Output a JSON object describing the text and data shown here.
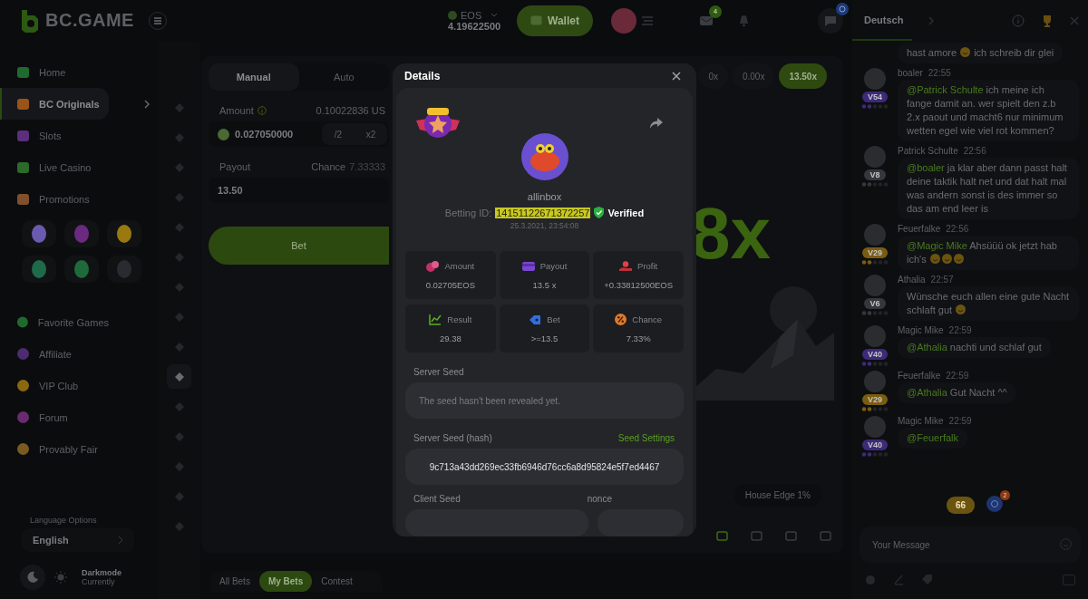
{
  "header": {
    "logo": "BC.GAME",
    "currency": "EOS",
    "balance": "4.19622500",
    "wallet": "Wallet",
    "mail_badge": "4"
  },
  "sidebar": {
    "items": [
      {
        "label": "Home",
        "selected": false
      },
      {
        "label": "BC Originals",
        "selected": true
      },
      {
        "label": "Slots",
        "selected": false
      },
      {
        "label": "Live Casino",
        "selected": false
      },
      {
        "label": "Promotions",
        "selected": false
      }
    ],
    "more_items": [
      {
        "label": "Favorite Games",
        "selected": false
      },
      {
        "label": "Affiliate",
        "selected": false
      },
      {
        "label": "VIP Club",
        "selected": false
      },
      {
        "label": "Forum",
        "selected": false
      },
      {
        "label": "Provably Fair",
        "selected": false
      }
    ],
    "language_label": "Language Options",
    "language": "English",
    "theme_title": "Darkmode",
    "theme_subtitle": "Currently"
  },
  "game_rail": [
    {
      "selected": false
    },
    {
      "selected": false
    },
    {
      "selected": false
    },
    {
      "selected": false
    },
    {
      "selected": false
    },
    {
      "selected": false
    },
    {
      "selected": false
    },
    {
      "selected": false
    },
    {
      "selected": false
    },
    {
      "selected": true
    },
    {
      "selected": false
    },
    {
      "selected": false
    },
    {
      "selected": false
    },
    {
      "selected": false
    },
    {
      "selected": false
    }
  ],
  "game": {
    "tabs": [
      {
        "label": "Manual",
        "selected": true
      },
      {
        "label": "Auto",
        "selected": false
      }
    ],
    "amount_label": "Amount",
    "amount_usd": "0.10022836 US",
    "amount_value": "0.027050000",
    "amount_buttons": [
      "/2",
      "x2"
    ],
    "payout_label": "Payout",
    "chance_label": "Chance",
    "chance_value": "7.33333",
    "payout_value": "13.50",
    "bet_button": "Bet",
    "history": [
      {
        "label": "0x",
        "win": false
      },
      {
        "label": "0.00x",
        "win": false
      },
      {
        "label": "13.50x",
        "win": true
      }
    ],
    "result": "8x",
    "house_edge": "House Edge 1%",
    "toolbar": [
      {
        "selected": true
      },
      {
        "selected": false
      },
      {
        "selected": false
      },
      {
        "selected": false
      }
    ]
  },
  "bets_tabs": [
    {
      "label": "All Bets",
      "selected": false
    },
    {
      "label": "My Bets",
      "selected": true
    },
    {
      "label": "Contest",
      "selected": false
    }
  ],
  "details": {
    "title": "Details",
    "username": "allinbox",
    "betting_id_label": "Betting ID:",
    "betting_id": "14151122671372257",
    "verified": "Verified",
    "date": "25.3.2021, 23:54:08",
    "stats": [
      {
        "kind": "amount",
        "label": "Amount",
        "value": "0.02705EOS"
      },
      {
        "kind": "payout",
        "label": "Payout",
        "value": "13.5 x"
      },
      {
        "kind": "profit",
        "label": "Profit",
        "value": "+0.33812500EOS"
      },
      {
        "kind": "result",
        "label": "Result",
        "value": "29.38"
      },
      {
        "kind": "bet",
        "label": "Bet",
        "value": ">=13.5"
      },
      {
        "kind": "chance",
        "label": "Chance",
        "value": "7.33%"
      }
    ],
    "server_seed_label": "Server Seed",
    "server_seed": "The seed hasn't been revealed yet.",
    "hash_label": "Server Seed (hash)",
    "seed_settings": "Seed Settings",
    "hash": "9c713a43dd269ec33fb6946d76cc6a8d95824e5f7ed4467",
    "client_seed_label": "Client Seed",
    "nonce_label": "nonce"
  },
  "chat": {
    "tab": "Deutsch",
    "placeholder": "Your Message",
    "unread": "66",
    "mention_badge": "2",
    "messages": [
      {
        "parts": [
          {
            "kind": "text",
            "text": "hast amore "
          },
          {
            "kind": "emoji"
          },
          {
            "kind": "text",
            "text": " ich schreib dir glei"
          }
        ]
      },
      {
        "name": "boaler",
        "time": "22:55",
        "level": "V54",
        "color": "#3d2a78",
        "parts": [
          {
            "kind": "mention",
            "text": "@Patrick Schulte"
          },
          {
            "kind": "text",
            "text": " ich meine ich fange damit an. wer spielt den z.b 2.x paout und macht6 nur minimum wetten egel wie viel rot kommen?"
          }
        ]
      },
      {
        "name": "Patrick Schulte",
        "time": "22:56",
        "level": "V8",
        "color": "#36373d",
        "parts": [
          {
            "kind": "mention",
            "text": "@boaler"
          },
          {
            "kind": "text",
            "text": " ja klar aber dann passt halt deine taktik halt net und dat halt mal was andern sonst is des immer so das am end leer is"
          }
        ]
      },
      {
        "name": "Feuerfalke",
        "time": "22:56",
        "level": "V29",
        "color": "#7a5c10",
        "parts": [
          {
            "kind": "mention",
            "text": "@Magic Mike"
          },
          {
            "kind": "text",
            "text": " Ahsüüü ok jetzt hab ich's "
          },
          {
            "kind": "emoji"
          },
          {
            "kind": "emoji"
          },
          {
            "kind": "emoji"
          }
        ]
      },
      {
        "name": "Athalia",
        "time": "22:57",
        "level": "V6",
        "color": "#36373d",
        "parts": [
          {
            "kind": "text",
            "text": "Wünsche euch allen eine gute Nacht schlaft gut "
          },
          {
            "kind": "emoji"
          }
        ]
      },
      {
        "name": "Magic Mike",
        "time": "22:59",
        "level": "V40",
        "color": "#3d2a78",
        "parts": [
          {
            "kind": "mention",
            "text": "@Athalia"
          },
          {
            "kind": "text",
            "text": " nachti und schlaf gut"
          }
        ]
      },
      {
        "name": "Feuerfalke",
        "time": "22:59",
        "level": "V29",
        "color": "#7a5c10",
        "parts": [
          {
            "kind": "mention",
            "text": "@Athalia"
          },
          {
            "kind": "text",
            "text": " Gut Nacht ^^"
          }
        ]
      },
      {
        "name": "Magic Mike",
        "time": "22:59",
        "level": "V40",
        "color": "#3d2a78",
        "parts": [
          {
            "kind": "mention",
            "text": "@Feuerfalk"
          }
        ]
      }
    ]
  }
}
